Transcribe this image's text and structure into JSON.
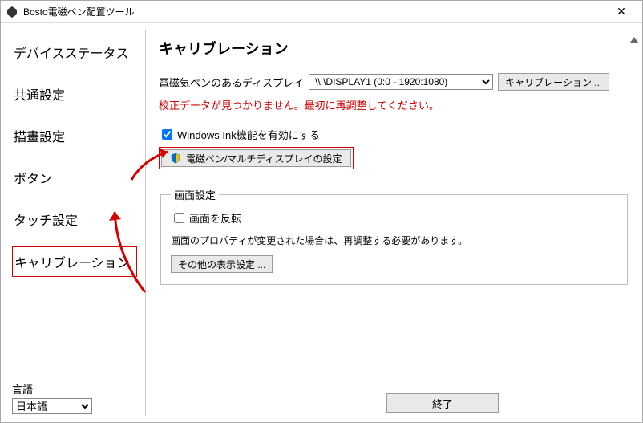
{
  "window": {
    "title": "Bosto電磁ペン配置ツール"
  },
  "sidebar": {
    "items": [
      {
        "label": "デバイスステータス"
      },
      {
        "label": "共通設定"
      },
      {
        "label": "描畫設定"
      },
      {
        "label": "ボタン"
      },
      {
        "label": "タッチ設定"
      },
      {
        "label": "キャリブレーション"
      }
    ]
  },
  "language": {
    "label": "言語",
    "value": "日本語"
  },
  "content": {
    "title": "キャリブレーション",
    "display_label": "電磁気ペンのあるディスプレイ",
    "display_value": "\\\\.\\DISPLAY1 (0:0 - 1920:1080)",
    "calibrate_btn": "キャリブレーション ...",
    "warning": "校正データが見つかりません。最初に再調整してください。",
    "ink_checkbox": "Windows Ink機能を有効にする",
    "pen_settings_btn": "電磁ペン/マルチディスプレイの設定",
    "screen_group": {
      "legend": "画面設定",
      "flip_checkbox": "画面を反転",
      "note": "画面のプロパティが変更された場合は、再調整する必要があります。",
      "other_btn": "その他の表示設定 ..."
    }
  },
  "footer": {
    "exit": "終了"
  }
}
